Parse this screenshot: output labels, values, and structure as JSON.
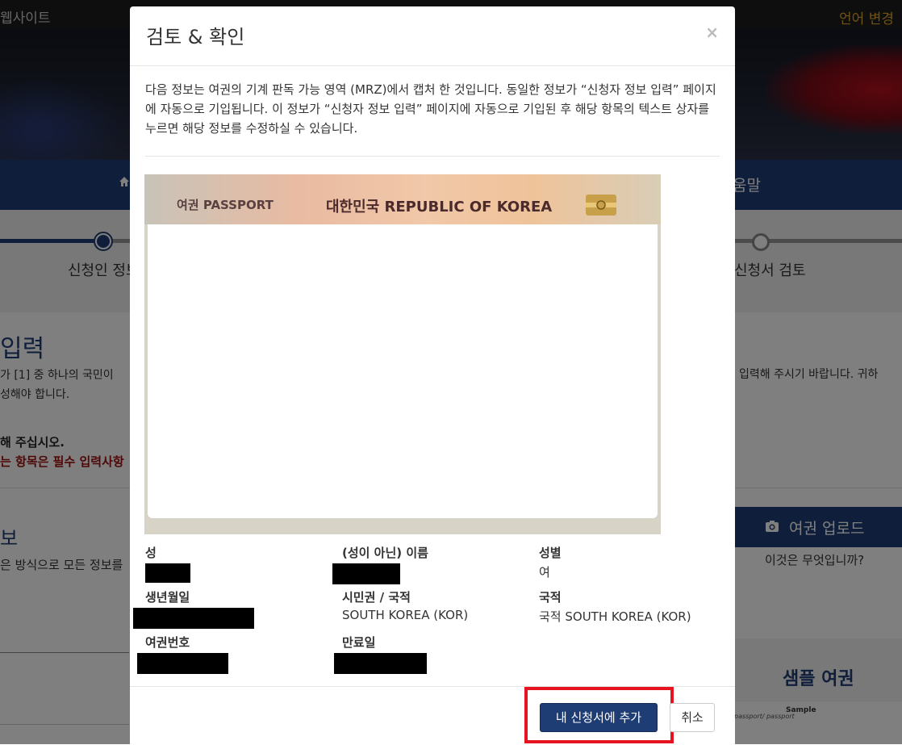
{
  "background": {
    "site_label": "웹사이트",
    "language_label": "언어 변경",
    "nav_help": "움말",
    "steps": [
      "신청인 정보",
      "신청서 검토"
    ],
    "section_title": "입력",
    "note_left_1": "가 [1] 중 하나의 국민이",
    "note_left_2": "성해야 합니다.",
    "note_right": "입력해 주시기 바랍니다. 귀하",
    "bold_line": "해 주십시오.",
    "required_line": "는 항목은 필수 입력사항",
    "info_title": "보",
    "info_note": "은 방식으로 모든 정보를",
    "upload_button": "여권 업로드",
    "what_is": "이것은 무엇입니까?",
    "sample_title": "샘플 여권",
    "sample_small": "Sample",
    "sample_small2": "passport/ passport"
  },
  "modal": {
    "title": "검토 & 확인",
    "close": "×",
    "description": "다음 정보는 여권의 기계 판독 가능 영역 (MRZ)에서 캡처 한 것입니다. 동일한 정보가 “신청자 정보 입력” 페이지에 자동으로 기입됩니다. 이 정보가 “신청자 정보 입력” 페이지에 자동으로 기입된 후 해당 항목의 텍스트 상자를 누르면 해당 정보를 수정하실 수 있습니다.",
    "passport_image": {
      "label_kr": "여권  PASSPORT",
      "label_country": "대한민국  REPUBLIC OF KOREA"
    },
    "fields": {
      "surname_label": "성",
      "given_label": "(성이 아닌) 이름",
      "sex_label": "성별",
      "sex_value": "여",
      "dob_label": "생년월일",
      "citizenship_label": "시민권 / 국적",
      "citizenship_value": "SOUTH KOREA (KOR)",
      "nationality_label": "국적",
      "nationality_value": "국적 SOUTH KOREA (KOR)",
      "passport_no_label": "여권번호",
      "expiry_label": "만료일"
    },
    "add_button": "내 신청서에 추가",
    "cancel_button": "취소"
  }
}
